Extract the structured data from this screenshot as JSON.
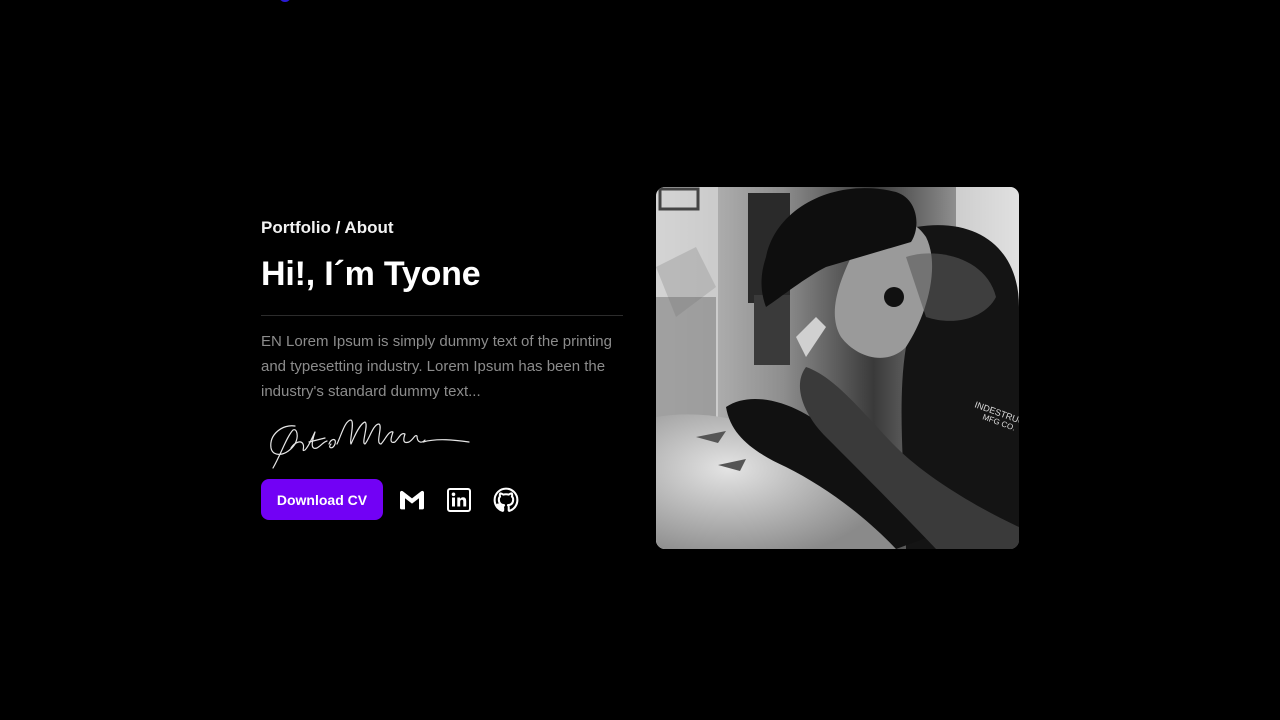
{
  "header": {
    "breadcrumb": "Portfolio / About"
  },
  "hero": {
    "title": "Hi!, I´m Tyone",
    "bio": "EN Lorem Ipsum is simply dummy text of the printing and typesetting industry. Lorem Ipsum has been the industry's standard dummy text...",
    "signature_icon": "handwritten-signature"
  },
  "actions": {
    "download_cv_label": "Download CV",
    "social_links": [
      {
        "icon": "gmail-icon"
      },
      {
        "icon": "linkedin-icon"
      },
      {
        "icon": "github-icon"
      }
    ]
  },
  "photo": {
    "description_icon": "tattoo-artist-photo"
  },
  "colors": {
    "background": "#000000",
    "accent": "#7201f5",
    "text_primary": "#ffffff",
    "text_muted": "#8c8c8c",
    "divider": "#2c2c2c"
  }
}
